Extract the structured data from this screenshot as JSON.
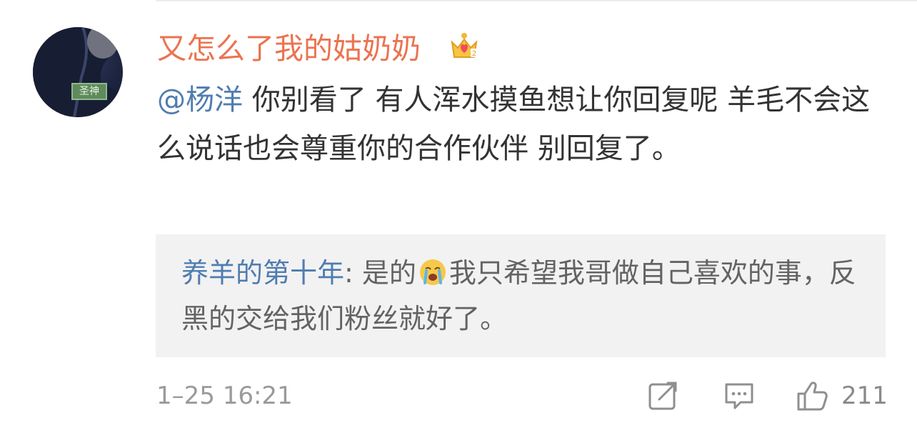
{
  "comment": {
    "username": "又怎么了我的姑奶奶",
    "mention": "@杨洋",
    "text": " 你别看了 有人浑水摸鱼想让你回复呢 羊毛不会这么说话也会尊重你的合作伙伴 别回复了。",
    "badge_text": "圣神",
    "badge_icon": "crown-icon"
  },
  "reply": {
    "author": "养羊的第十年",
    "separator": ": ",
    "text_before_emoji": "是的",
    "emoji": "cry-icon",
    "text_after_emoji": "我只希望我哥做自己喜欢的事，反黑的交给我们粉丝就好了。"
  },
  "footer": {
    "timestamp": "1–25 16:21",
    "like_count": "211",
    "icons": [
      "share-icon",
      "comment-icon",
      "like-icon"
    ]
  },
  "colors": {
    "username": "#eb7350",
    "link": "#4f7db0",
    "text": "#333333",
    "reply_bg": "#f2f2f2",
    "meta": "#9a9a9a"
  }
}
